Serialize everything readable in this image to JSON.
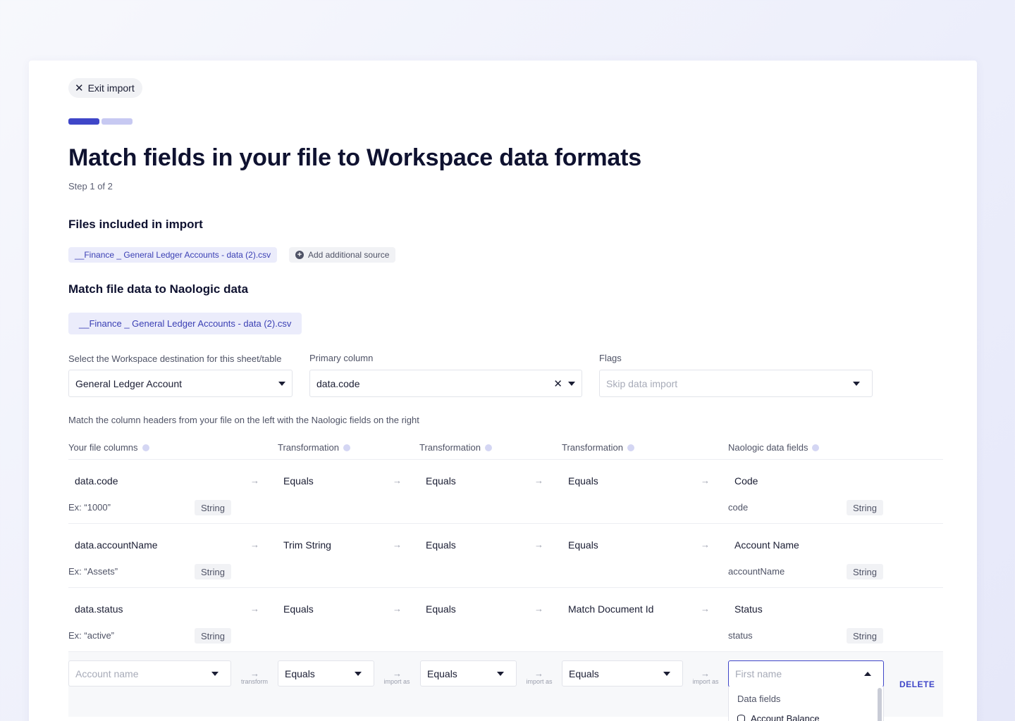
{
  "header": {
    "exit_label": "Exit import",
    "title": "Match fields in your file to Workspace data formats",
    "step": "Step 1 of 2"
  },
  "progress": {
    "current_step": 1,
    "total_steps": 2
  },
  "files_section": {
    "title": "Files included in import",
    "file_name": "__Finance _ General Ledger Accounts - data (2).csv",
    "add_source_label": "Add additional source"
  },
  "match_section": {
    "title": "Match file data to Naologic data",
    "sheet_name": "__Finance _ General Ledger Accounts - data (2).csv",
    "destination_label": "Select the Workspace destination for this sheet/table",
    "destination_value": "General Ledger Account",
    "primary_label": "Primary column",
    "primary_value": "data.code",
    "flags_label": "Flags",
    "flags_placeholder": "Skip data import",
    "instructions": "Match the column headers from your file on the left with the Naologic fields on the right"
  },
  "columns": {
    "file": "Your file columns",
    "t1": "Transformation",
    "t2": "Transformation",
    "t3": "Transformation",
    "naologic": "Naologic data fields"
  },
  "rows": [
    {
      "source": "data.code",
      "example": "Ex: “1000”",
      "type": "String",
      "t1": "Equals",
      "t2": "Equals",
      "t3": "Equals",
      "target": "Code",
      "target_key": "code",
      "target_type": "String"
    },
    {
      "source": "data.accountName",
      "example": "Ex: “Assets”",
      "type": "String",
      "t1": "Trim String",
      "t2": "Equals",
      "t3": "Equals",
      "target": "Account Name",
      "target_key": "accountName",
      "target_type": "String"
    },
    {
      "source": "data.status",
      "example": "Ex: “active”",
      "type": "String",
      "t1": "Equals",
      "t2": "Equals",
      "t3": "Match Document Id",
      "target": "Status",
      "target_key": "status",
      "target_type": "String"
    }
  ],
  "edit_row": {
    "source_placeholder": "Account name",
    "t1": "Equals",
    "t2": "Equals",
    "t3": "Equals",
    "target_placeholder": "First name",
    "lbl_transform": "transform",
    "lbl_import1": "import as",
    "lbl_import2": "import as",
    "lbl_import3": "import as",
    "delete_label": "DELETE",
    "dropdown_group": "Data fields",
    "dropdown_option": "Account Balance"
  },
  "colors": {
    "accent": "#3f46c8",
    "chip_bg": "#ebecfb"
  }
}
